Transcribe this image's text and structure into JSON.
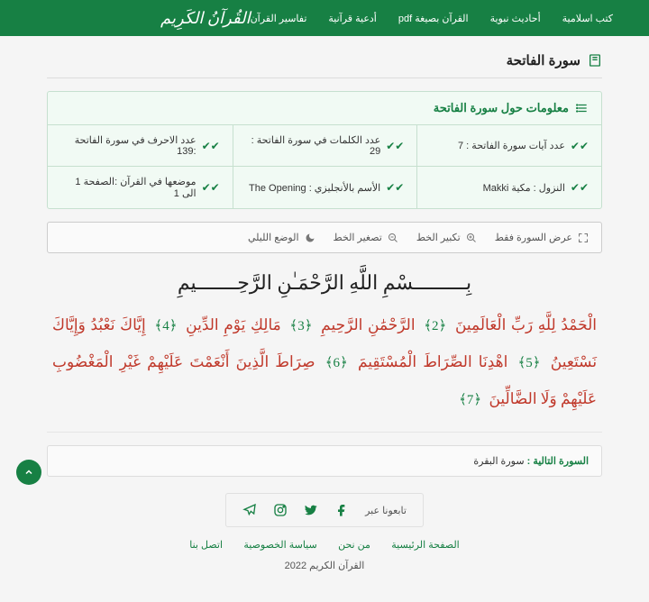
{
  "nav": {
    "logo": "القُرآنُ الكَرِيم",
    "items": [
      "كتب اسلامية",
      "أحاديث نبوية",
      "القرآن بصيغة pdf",
      "أدعية قرآنية",
      "تفاسير القرآن"
    ]
  },
  "page_title": "سورة الفاتحة",
  "info": {
    "heading": "معلومات حول سورة الفاتحة",
    "rows": [
      [
        "عدد آيات سورة الفاتحة : 7",
        "عدد الكلمات في سورة الفاتحة : 29",
        "عدد الاحرف في سورة الفاتحة :139"
      ],
      [
        "النزول : مكية Makki",
        "الأسم بالأنجليزي : The Opening",
        "موضعها في القرآن :الصفحة 1 الى 1"
      ]
    ]
  },
  "toolbar": {
    "fullscreen": "عرض السورة فقط",
    "zoom_in": "تكبير الخط",
    "zoom_out": "تصغير الخط",
    "night": "الوضع الليلي"
  },
  "bismillah": "بِـــــــــسْمِ اللَّهِ الرَّحْمَـٰنِ الرَّحِـــــــيمِ",
  "ayat": [
    {
      "t": "الْحَمْدُ لِلَّهِ رَبِّ الْعَالَمِينَ",
      "n": "﴿2﴾"
    },
    {
      "t": "الرَّحْمَٰنِ الرَّحِيمِ",
      "n": "﴿3﴾"
    },
    {
      "t": "مَالِكِ يَوْمِ الدِّينِ",
      "n": "﴿4﴾"
    },
    {
      "t": "إِيَّاكَ نَعْبُدُ وَإِيَّاكَ نَسْتَعِينُ",
      "n": "﴿5﴾"
    },
    {
      "t": "اهْدِنَا الصِّرَاطَ الْمُسْتَقِيمَ",
      "n": "﴿6﴾"
    },
    {
      "t": "صِرَاطَ الَّذِينَ أَنْعَمْتَ عَلَيْهِمْ غَيْرِ الْمَغْضُوبِ عَلَيْهِمْ وَلَا الضَّالِّينَ",
      "n": "﴿7﴾"
    }
  ],
  "next": {
    "label": "السورة التالية :",
    "value": "سورة البقرة"
  },
  "follow": {
    "label": "تابعونا عبر"
  },
  "footer_links": [
    "الصفحة الرئيسية",
    "من نحن",
    "سياسة الخصوصية",
    "اتصل بنا"
  ],
  "copyright": "القرآن الكريم 2022"
}
